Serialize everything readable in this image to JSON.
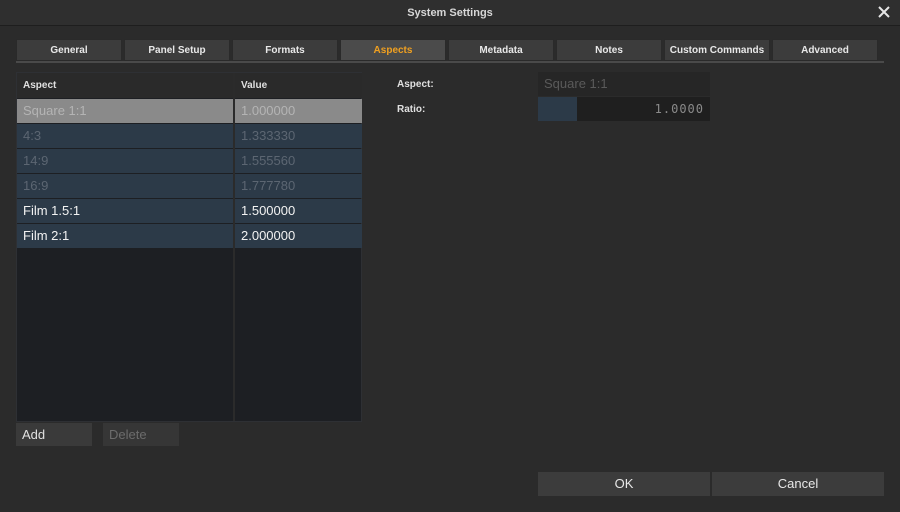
{
  "window": {
    "title": "System Settings",
    "close_icon": "close-icon"
  },
  "tabs": [
    {
      "label": "General"
    },
    {
      "label": "Panel Setup"
    },
    {
      "label": "Formats"
    },
    {
      "label": "Aspects",
      "active": true
    },
    {
      "label": "Metadata"
    },
    {
      "label": "Notes"
    },
    {
      "label": "Custom Commands"
    },
    {
      "label": "Advanced"
    }
  ],
  "colors": {
    "accent": "#f0a020",
    "row_bg": "#2c3a48",
    "selected_bg": "#8a8a8a",
    "dim_text": "#5c6672"
  },
  "table": {
    "headers": {
      "aspect": "Aspect",
      "value": "Value"
    },
    "rows": [
      {
        "aspect": "Square 1:1",
        "value": "1.000000",
        "state": "selected"
      },
      {
        "aspect": "4:3",
        "value": "1.333330",
        "state": "dim"
      },
      {
        "aspect": "14:9",
        "value": "1.555560",
        "state": "dim"
      },
      {
        "aspect": "16:9",
        "value": "1.777780",
        "state": "dim"
      },
      {
        "aspect": "Film 1.5:1",
        "value": "1.500000",
        "state": "normal"
      },
      {
        "aspect": "Film 2:1",
        "value": "2.000000",
        "state": "normal"
      }
    ]
  },
  "buttons": {
    "add": "Add",
    "delete": "Delete",
    "ok": "OK",
    "cancel": "Cancel"
  },
  "detail": {
    "aspect_label": "Aspect:",
    "aspect_value": "Square 1:1",
    "ratio_label": "Ratio:",
    "ratio_value": "1.0000"
  }
}
